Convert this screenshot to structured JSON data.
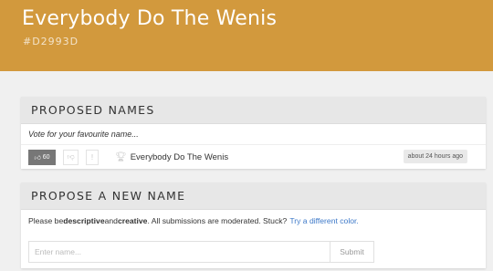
{
  "header": {
    "title": "Everybody Do The Wenis",
    "hex": "#D2993D",
    "color": "#D2993D"
  },
  "proposed": {
    "title": "PROPOSED NAMES",
    "subtitle": "Vote for your favourite name...",
    "entry": {
      "votes": "60",
      "name": "Everybody Do The Wenis",
      "time": "about 24 hours ago",
      "flag": "!"
    },
    "icons": {
      "upvote": "thumbs-up-icon",
      "downvote": "thumbs-down-icon",
      "trophy": "trophy-icon"
    }
  },
  "propose": {
    "title": "PROPOSE A NEW NAME",
    "note_pre": "Please be ",
    "note_bold1": "descriptive",
    "note_mid": " and ",
    "note_bold2": "creative",
    "note_post": ". All submissions are moderated. Stuck?",
    "link": "Try a different color.",
    "input_placeholder": "Enter name...",
    "input_value": "",
    "submit_label": "Submit"
  }
}
